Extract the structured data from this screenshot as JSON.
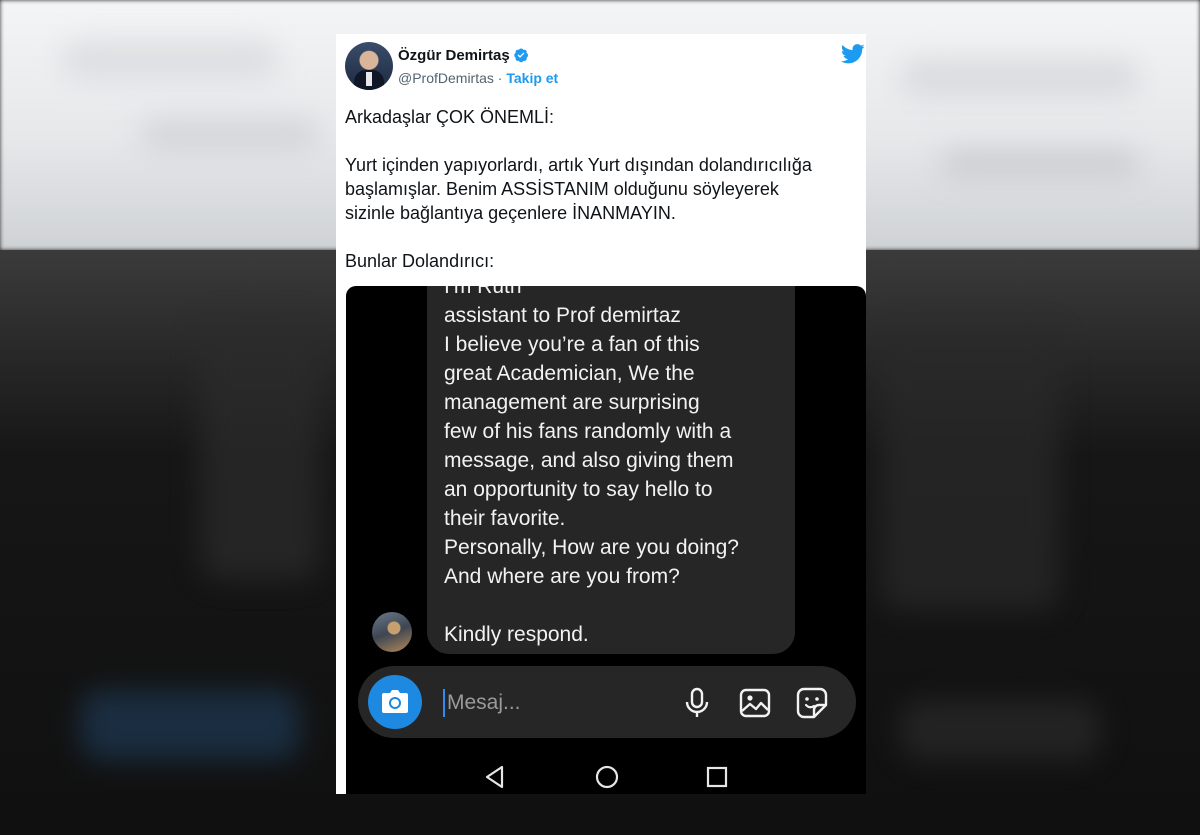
{
  "tweet": {
    "author": {
      "name": "Özgür Demirtaş",
      "handle": "@ProfDemirtas",
      "separator": " · ",
      "follow_label": "Takip et"
    },
    "text": {
      "line1": "Arkadaşlar ÇOK ÖNEMLİ:",
      "line2": "Yurt içinden yapıyorlardı, artık Yurt dışından dolandırıcılığa",
      "line3": "başlamışlar. Benim ASSİSTANIM olduğunu söyleyerek",
      "line4": "sizinle bağlantıya geçenlere İNANMAYIN.",
      "line5": "Bunlar Dolandırıcı:"
    }
  },
  "media": {
    "message": {
      "lines": [
        "I'm Ruth",
        "assistant to Prof demirtaz",
        "I believe you’re a fan of this",
        "great Academician, We the",
        "management are surprising",
        "few of his fans randomly with a",
        "message, and also giving them",
        "an opportunity to say hello to",
        "their favorite.",
        "Personally, How are you doing?",
        "And where are you from?",
        "Kindly respond."
      ]
    },
    "input": {
      "placeholder": "Mesaj..."
    },
    "icons": {
      "camera": "camera-icon",
      "mic": "microphone-icon",
      "gallery": "image-gallery-icon",
      "sticker": "sticker-icon",
      "back": "back-triangle-icon",
      "home": "home-circle-icon",
      "recent": "recent-apps-square-icon"
    },
    "colors": {
      "accent": "#1d89e0",
      "bubble": "#262626"
    }
  },
  "colors": {
    "twitter_blue": "#1d9bf0",
    "text": "#0f1419",
    "muted": "#536471"
  }
}
